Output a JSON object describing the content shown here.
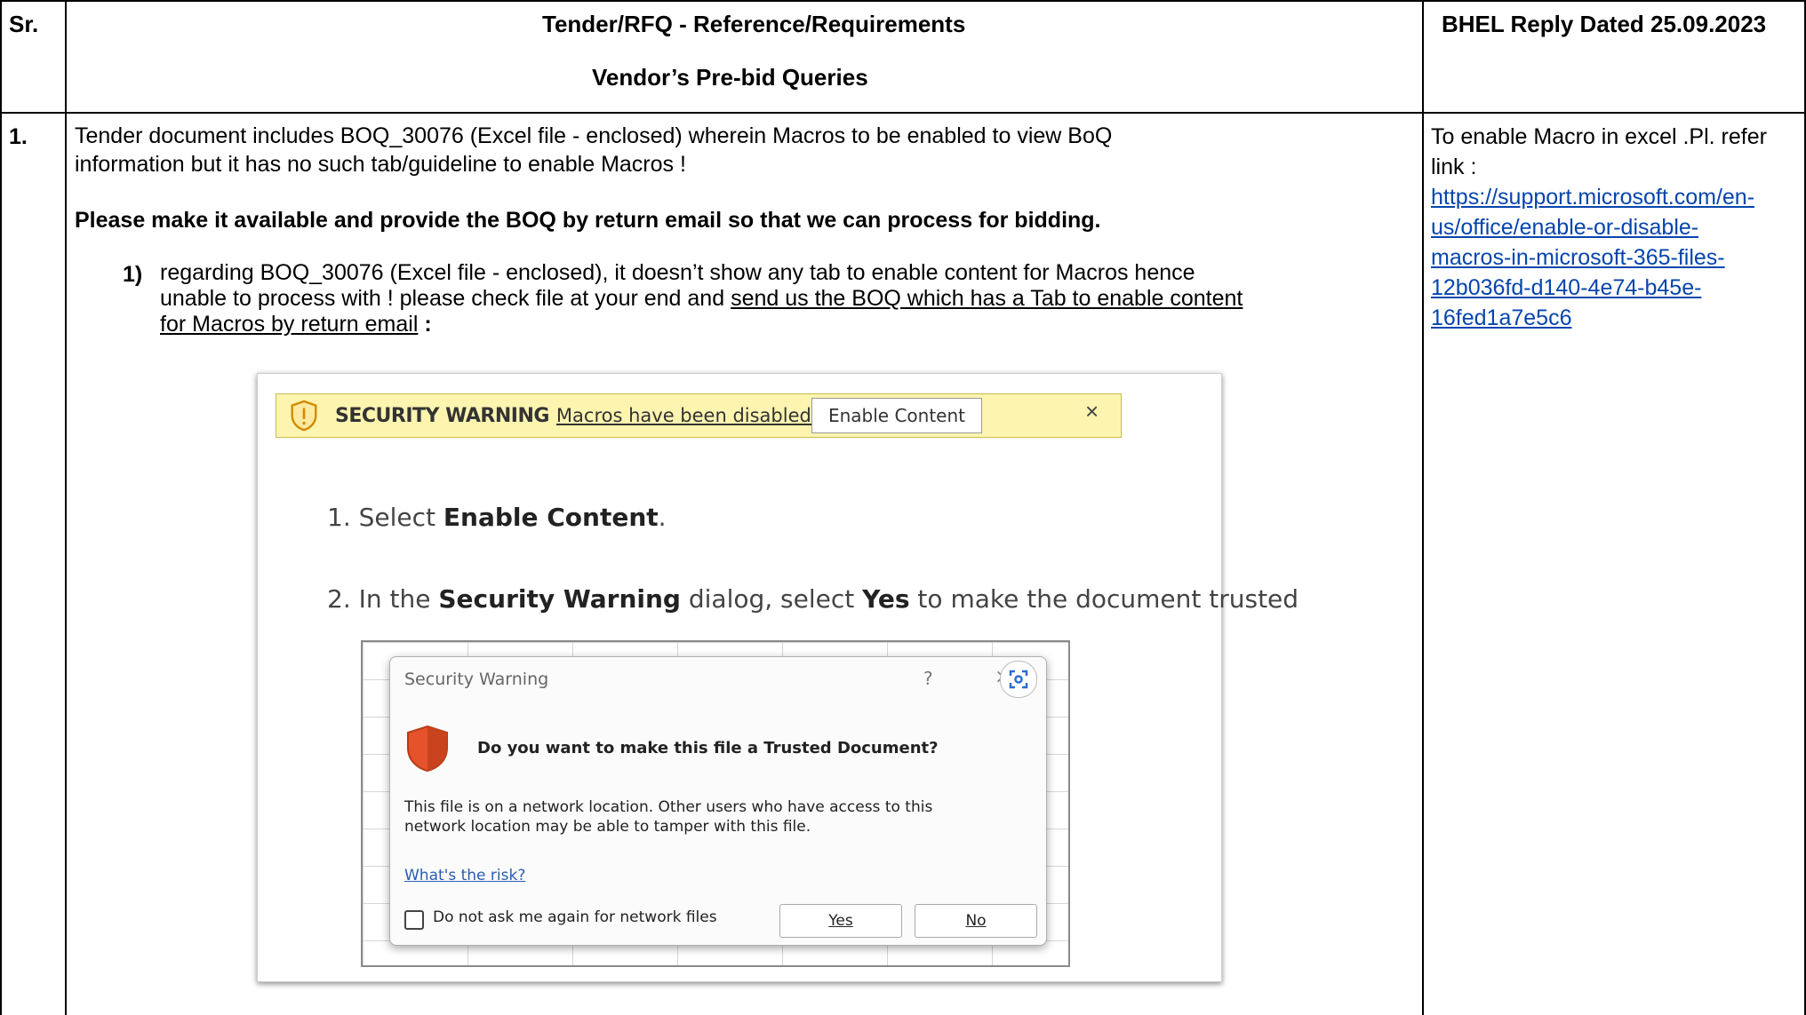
{
  "header": {
    "sr": "Sr.",
    "reference_title": "Tender/RFQ - Reference/Requirements",
    "reference_subtitle": "Vendor’s Pre-bid Queries",
    "reply_title": "BHEL Reply Dated 25.09.2023"
  },
  "row1": {
    "sr": "1.",
    "para1_line1": "Tender document includes BOQ_30076 (Excel file - enclosed) wherein Macros to be enabled to view BoQ",
    "para1_line2": "information but it has no such tab/guideline to enable Macros !",
    "para2": "Please make it available and provide the BOQ by return email so that we can process for bidding.",
    "item_num": "1)",
    "item_line1": "regarding BOQ_30076 (Excel file - enclosed), it doesn’t show any tab to enable content for Macros hence",
    "item_line2_a": "unable to process with ! please check file at your end and ",
    "item_line2_b": "send us the BOQ which has a Tab to enable content",
    "item_line3_a": "for Macros by return email",
    "item_line3_b": " :",
    "reply_text": "To enable Macro in excel .Pl. refer link :",
    "reply_link_lines": [
      "https://support.microsoft.com/en-",
      "us/office/enable-or-disable-",
      "macros-in-microsoft-365-files-",
      "12b036fd-d140-4e74-b45e-",
      "16fed1a7e5c6"
    ]
  },
  "screenshot": {
    "bar_title": "SECURITY WARNING",
    "bar_message": "Macros have been disabled.",
    "enable_button": "Enable Content",
    "close_glyph": "×",
    "step1_prefix": "1.  Select ",
    "step1_bold": "Enable Content",
    "step1_suffix": ".",
    "step2_prefix": "2.  In the ",
    "step2_bold1": "Security Warning",
    "step2_mid": " dialog, select ",
    "step2_bold2": "Yes",
    "step2_suffix": " to make the document trusted",
    "dialog": {
      "title": "Security Warning",
      "help": "?",
      "close": "×",
      "question": "Do you want to make this file a Trusted Document?",
      "body_line1": "This file is on a network location. Other users who have access to this",
      "body_line2": "network location may be able to tamper with this file.",
      "risk_link": "What's the risk?",
      "checkbox_label": "Do not ask me again for network files",
      "yes": "Yes",
      "no": "No"
    }
  }
}
